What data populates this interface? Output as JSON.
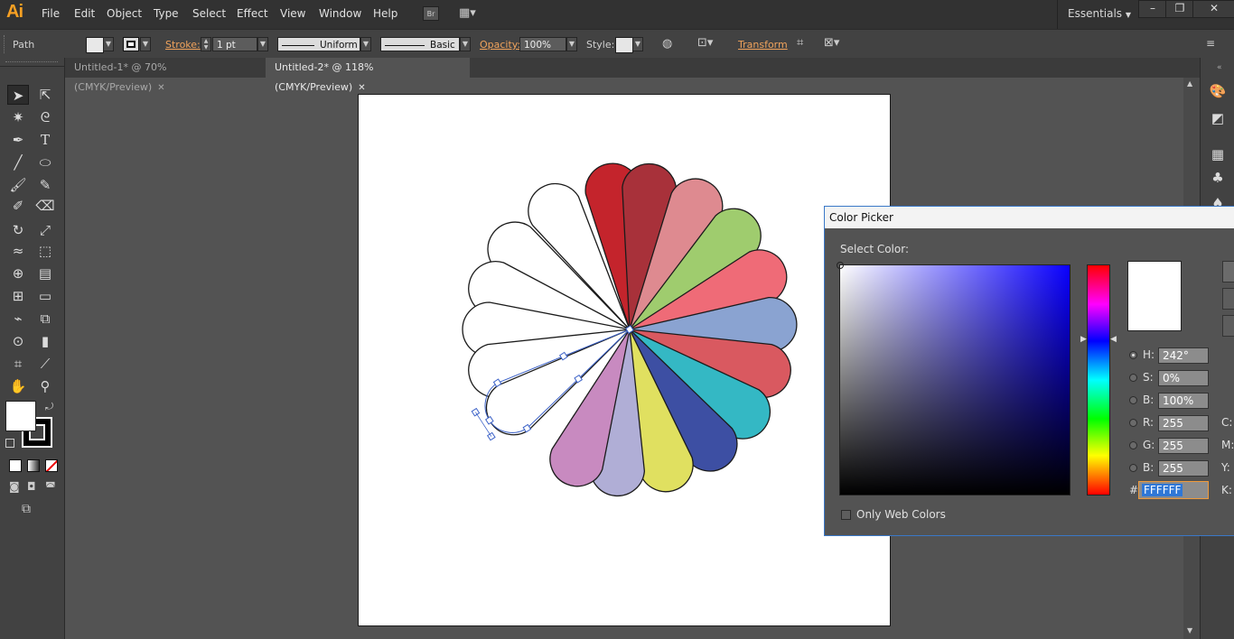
{
  "app": {
    "logo": "Ai",
    "workspace": "Essentials"
  },
  "menu": [
    "File",
    "Edit",
    "Object",
    "Type",
    "Select",
    "Effect",
    "View",
    "Window",
    "Help"
  ],
  "menu_extra": {
    "bridge": "Br"
  },
  "controlbar": {
    "selection_type": "Path",
    "stroke_label": "Stroke:",
    "stroke_weight": "1 pt",
    "profile": "Uniform",
    "brush": "Basic",
    "opacity_label": "Opacity:",
    "opacity": "100%",
    "style_label": "Style:",
    "transform_label": "Transform"
  },
  "tabs": [
    {
      "label": "Untitled-1* @ 70% (CMYK/Preview)",
      "active": false
    },
    {
      "label": "Untitled-2* @ 118% (CMYK/Preview)",
      "active": true
    }
  ],
  "artwork": {
    "petal_colors": [
      "#c4242c",
      "#a8313a",
      "#de8a90",
      "#9fcc6e",
      "#ef6b77",
      "#8aa3d1",
      "#d95960",
      "#34b8c4",
      "#3d4fa3",
      "#e0e060",
      "#b0aed6",
      "#c88ac0"
    ],
    "white_petals": 6
  },
  "color_picker": {
    "title": "Color Picker",
    "select_label": "Select Color:",
    "fields": [
      {
        "label": "H:",
        "value": "242°",
        "selected": true
      },
      {
        "label": "S:",
        "value": "0%",
        "selected": false
      },
      {
        "label": "B:",
        "value": "100%",
        "selected": false
      },
      {
        "label": "R:",
        "value": "255",
        "selected": false
      },
      {
        "label": "G:",
        "value": "255",
        "selected": false
      },
      {
        "label": "B:",
        "value": "255",
        "selected": false
      }
    ],
    "cmyk_labels": [
      "C:",
      "M:",
      "Y:",
      "K:"
    ],
    "hex_label": "#",
    "hex_value": "FFFFFF",
    "only_web_colors": "Only Web Colors",
    "new_color": "#ffffff",
    "field_hue_color": "#0a00ff"
  }
}
